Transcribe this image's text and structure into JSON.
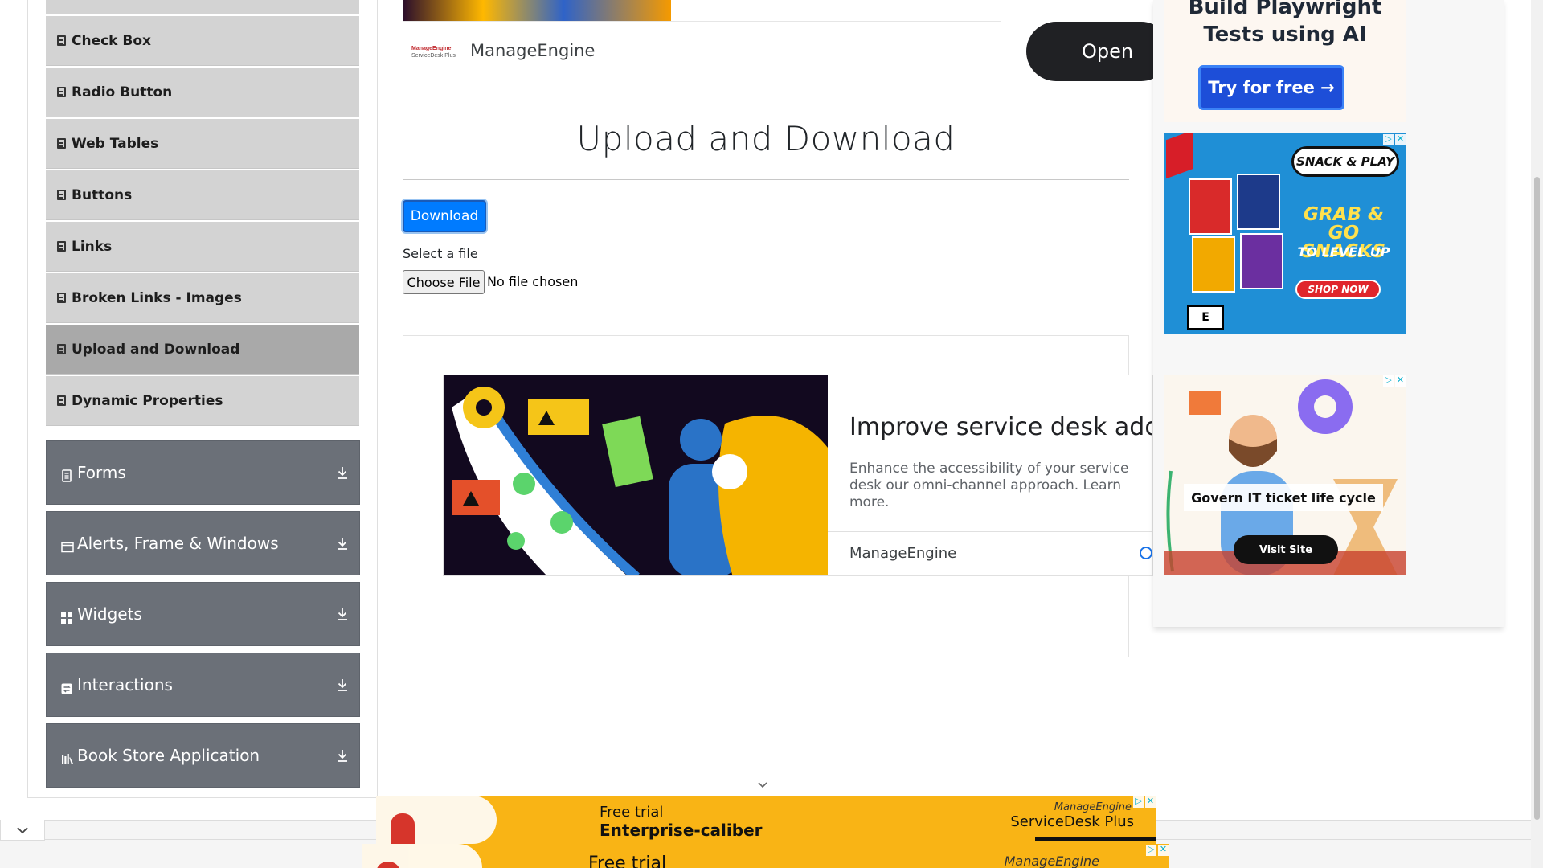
{
  "sidebar": {
    "elements_items": [
      {
        "label": "Check Box",
        "active": false
      },
      {
        "label": "Radio Button",
        "active": false
      },
      {
        "label": "Web Tables",
        "active": false
      },
      {
        "label": "Buttons",
        "active": false
      },
      {
        "label": "Links",
        "active": false
      },
      {
        "label": "Broken Links - Images",
        "active": false
      },
      {
        "label": "Upload and Download",
        "active": true
      },
      {
        "label": "Dynamic Properties",
        "active": false
      }
    ],
    "groups": [
      {
        "label": "Forms",
        "icon": "document-icon"
      },
      {
        "label": "Alerts, Frame & Windows",
        "icon": "window-icon"
      },
      {
        "label": "Widgets",
        "icon": "grid-icon"
      },
      {
        "label": "Interactions",
        "icon": "interactions-icon"
      },
      {
        "label": "Book Store Application",
        "icon": "bookstore-icon"
      }
    ]
  },
  "top_ad": {
    "brand_logo_line1": "ManageEngine",
    "brand_logo_line2": "ServiceDesk Plus",
    "brand_name": "ManageEngine",
    "cta": "Open"
  },
  "main": {
    "title": "Upload and Download",
    "download_label": "Download",
    "select_label": "Select a file",
    "choose_file_label": "Choose File",
    "no_file_text": "No file chosen"
  },
  "inline_ad": {
    "headline": "Improve service desk adopti",
    "body": "Enhance the accessibility of your service desk our omni-channel approach. Learn more.",
    "brand": "ManageEngine"
  },
  "right_ads": {
    "playwright": {
      "title_line1": "Build Playwright",
      "title_line2": "Tests using AI",
      "cta": "Try for free →"
    },
    "snack": {
      "tag": "SNACK & PLAY",
      "headline_line1": "GRAB & GO",
      "headline_line2": "SNACKS",
      "subline": "TO LEVEL UP",
      "cta": "SHOP NOW",
      "rating": "E"
    },
    "it_ticket": {
      "tagline": "Govern IT ticket life cycle",
      "cta": "Visit Site"
    }
  },
  "bottom_banners": {
    "banner1": {
      "line1": "Free trial",
      "line2": "Enterprise-caliber",
      "brand_small": "ManageEngine",
      "brand_big": "ServiceDesk Plus"
    },
    "banner2": {
      "line1": "Free trial",
      "brand_small": "ManageEngine"
    }
  },
  "colors": {
    "sidebar_item_bg": "#d3d3d3",
    "sidebar_active_bg": "#a9a9a9",
    "group_bg": "#6b7078",
    "primary_button": "#007bff",
    "banner_yellow": "#f9b415"
  }
}
